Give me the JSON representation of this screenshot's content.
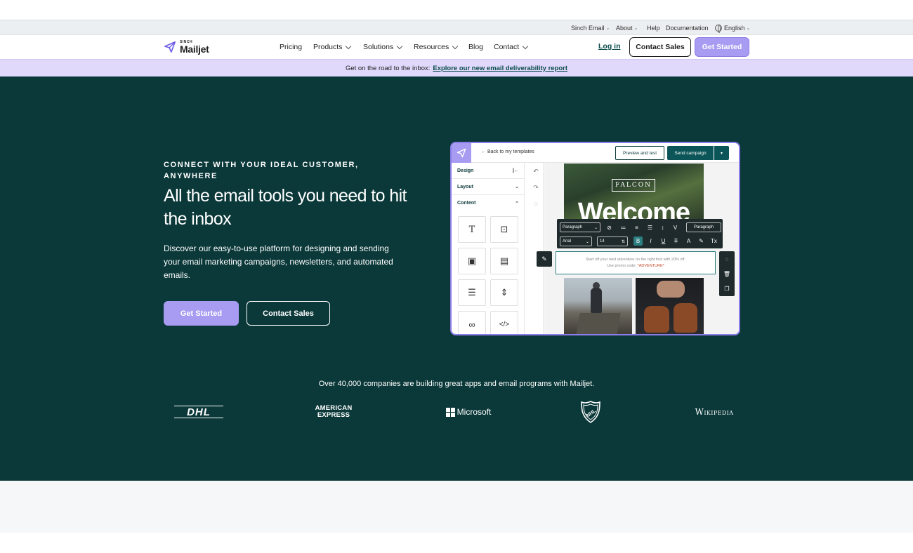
{
  "util_nav": {
    "sinch_email": "Sinch Email",
    "about": "About",
    "help": "Help",
    "documentation": "Documentation",
    "language": "English"
  },
  "brand": {
    "sinch": "SINCH",
    "name": "Mailjet"
  },
  "main_nav": {
    "items": [
      "Pricing",
      "Products",
      "Solutions",
      "Resources",
      "Blog",
      "Contact"
    ],
    "login": "Log in",
    "contact_sales": "Contact Sales",
    "get_started": "Get Started"
  },
  "banner": {
    "text": "Get on the road to the inbox:",
    "link": "Explore our new email deliverability report"
  },
  "hero": {
    "eyebrow": "CONNECT WITH YOUR IDEAL CUSTOMER, ANYWHERE",
    "headline": "All the email tools you need to hit the inbox",
    "subtext": "Discover our easy-to-use platform for designing and sending your email marketing campaigns, newsletters, and automated emails.",
    "cta_primary": "Get Started",
    "cta_secondary": "Contact Sales"
  },
  "editor": {
    "back": "← Back to my templates",
    "preview": "Preview and test",
    "send": "Send campaign",
    "side": {
      "design": "Design",
      "layout": "Layout",
      "content": "Content"
    },
    "falcon": "FALCON",
    "welcome": "Welcome",
    "format_paragraph": "Paragraph",
    "format_paragraph_btn": "Paragraph",
    "font": "Arial",
    "size": "14",
    "promo_line1": "Start off your next adventure on the right foot with 20% off.",
    "promo_line2": "Use promo code:",
    "promo_code": "*ADVENTURE*"
  },
  "trust": {
    "text": "Over 40,000 companies are building great apps and email programs with Mailjet.",
    "logos": {
      "dhl": "DHL",
      "amex_1": "AMERICAN",
      "amex_2": "EXPRESS",
      "microsoft": "Microsoft",
      "nhl": "NHL",
      "wikipedia": "Wikipedia"
    }
  },
  "colors": {
    "hero_bg": "#0b3839",
    "accent": "#a79bf2",
    "banner_bg": "#e0d9fb"
  }
}
